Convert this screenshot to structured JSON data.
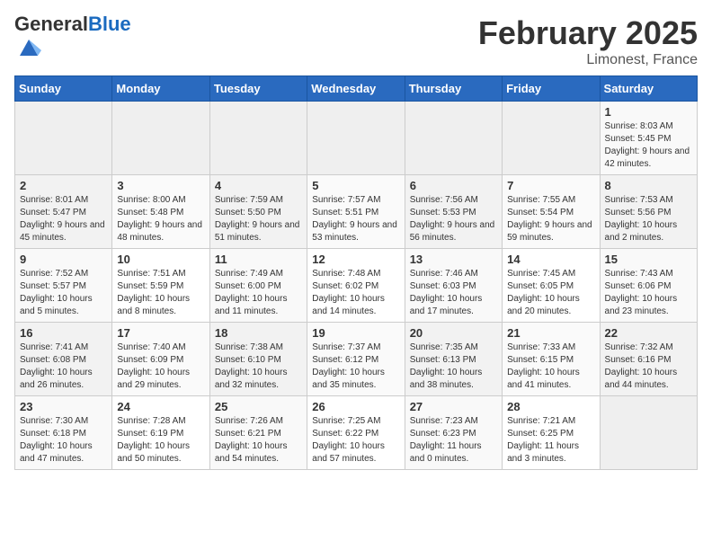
{
  "header": {
    "logo_general": "General",
    "logo_blue": "Blue",
    "month_year": "February 2025",
    "location": "Limonest, France"
  },
  "days_of_week": [
    "Sunday",
    "Monday",
    "Tuesday",
    "Wednesday",
    "Thursday",
    "Friday",
    "Saturday"
  ],
  "weeks": [
    [
      {
        "day": "",
        "info": ""
      },
      {
        "day": "",
        "info": ""
      },
      {
        "day": "",
        "info": ""
      },
      {
        "day": "",
        "info": ""
      },
      {
        "day": "",
        "info": ""
      },
      {
        "day": "",
        "info": ""
      },
      {
        "day": "1",
        "info": "Sunrise: 8:03 AM\nSunset: 5:45 PM\nDaylight: 9 hours and 42 minutes."
      }
    ],
    [
      {
        "day": "2",
        "info": "Sunrise: 8:01 AM\nSunset: 5:47 PM\nDaylight: 9 hours and 45 minutes."
      },
      {
        "day": "3",
        "info": "Sunrise: 8:00 AM\nSunset: 5:48 PM\nDaylight: 9 hours and 48 minutes."
      },
      {
        "day": "4",
        "info": "Sunrise: 7:59 AM\nSunset: 5:50 PM\nDaylight: 9 hours and 51 minutes."
      },
      {
        "day": "5",
        "info": "Sunrise: 7:57 AM\nSunset: 5:51 PM\nDaylight: 9 hours and 53 minutes."
      },
      {
        "day": "6",
        "info": "Sunrise: 7:56 AM\nSunset: 5:53 PM\nDaylight: 9 hours and 56 minutes."
      },
      {
        "day": "7",
        "info": "Sunrise: 7:55 AM\nSunset: 5:54 PM\nDaylight: 9 hours and 59 minutes."
      },
      {
        "day": "8",
        "info": "Sunrise: 7:53 AM\nSunset: 5:56 PM\nDaylight: 10 hours and 2 minutes."
      }
    ],
    [
      {
        "day": "9",
        "info": "Sunrise: 7:52 AM\nSunset: 5:57 PM\nDaylight: 10 hours and 5 minutes."
      },
      {
        "day": "10",
        "info": "Sunrise: 7:51 AM\nSunset: 5:59 PM\nDaylight: 10 hours and 8 minutes."
      },
      {
        "day": "11",
        "info": "Sunrise: 7:49 AM\nSunset: 6:00 PM\nDaylight: 10 hours and 11 minutes."
      },
      {
        "day": "12",
        "info": "Sunrise: 7:48 AM\nSunset: 6:02 PM\nDaylight: 10 hours and 14 minutes."
      },
      {
        "day": "13",
        "info": "Sunrise: 7:46 AM\nSunset: 6:03 PM\nDaylight: 10 hours and 17 minutes."
      },
      {
        "day": "14",
        "info": "Sunrise: 7:45 AM\nSunset: 6:05 PM\nDaylight: 10 hours and 20 minutes."
      },
      {
        "day": "15",
        "info": "Sunrise: 7:43 AM\nSunset: 6:06 PM\nDaylight: 10 hours and 23 minutes."
      }
    ],
    [
      {
        "day": "16",
        "info": "Sunrise: 7:41 AM\nSunset: 6:08 PM\nDaylight: 10 hours and 26 minutes."
      },
      {
        "day": "17",
        "info": "Sunrise: 7:40 AM\nSunset: 6:09 PM\nDaylight: 10 hours and 29 minutes."
      },
      {
        "day": "18",
        "info": "Sunrise: 7:38 AM\nSunset: 6:10 PM\nDaylight: 10 hours and 32 minutes."
      },
      {
        "day": "19",
        "info": "Sunrise: 7:37 AM\nSunset: 6:12 PM\nDaylight: 10 hours and 35 minutes."
      },
      {
        "day": "20",
        "info": "Sunrise: 7:35 AM\nSunset: 6:13 PM\nDaylight: 10 hours and 38 minutes."
      },
      {
        "day": "21",
        "info": "Sunrise: 7:33 AM\nSunset: 6:15 PM\nDaylight: 10 hours and 41 minutes."
      },
      {
        "day": "22",
        "info": "Sunrise: 7:32 AM\nSunset: 6:16 PM\nDaylight: 10 hours and 44 minutes."
      }
    ],
    [
      {
        "day": "23",
        "info": "Sunrise: 7:30 AM\nSunset: 6:18 PM\nDaylight: 10 hours and 47 minutes."
      },
      {
        "day": "24",
        "info": "Sunrise: 7:28 AM\nSunset: 6:19 PM\nDaylight: 10 hours and 50 minutes."
      },
      {
        "day": "25",
        "info": "Sunrise: 7:26 AM\nSunset: 6:21 PM\nDaylight: 10 hours and 54 minutes."
      },
      {
        "day": "26",
        "info": "Sunrise: 7:25 AM\nSunset: 6:22 PM\nDaylight: 10 hours and 57 minutes."
      },
      {
        "day": "27",
        "info": "Sunrise: 7:23 AM\nSunset: 6:23 PM\nDaylight: 11 hours and 0 minutes."
      },
      {
        "day": "28",
        "info": "Sunrise: 7:21 AM\nSunset: 6:25 PM\nDaylight: 11 hours and 3 minutes."
      },
      {
        "day": "",
        "info": ""
      }
    ]
  ]
}
